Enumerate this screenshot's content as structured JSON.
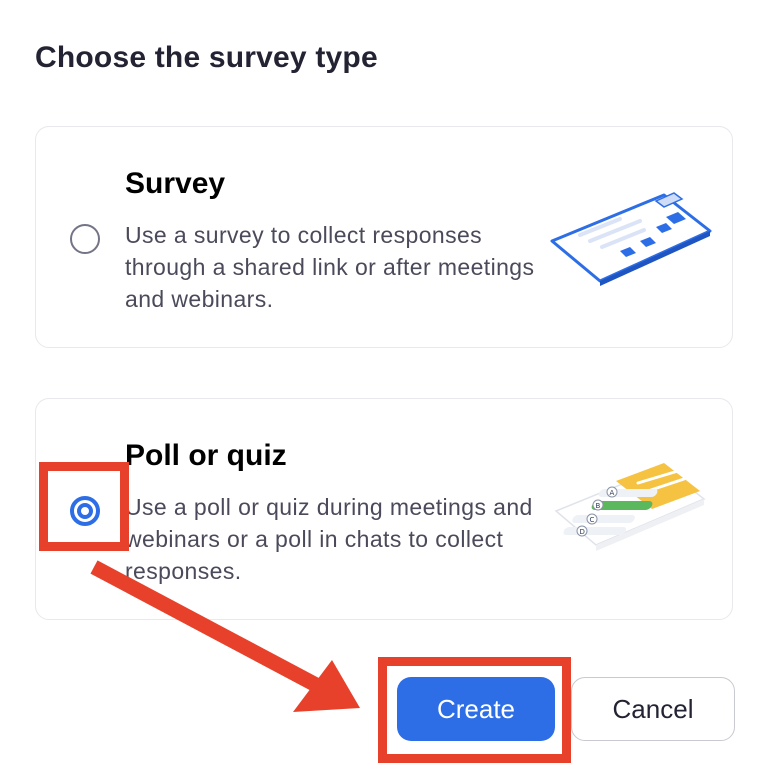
{
  "dialog": {
    "title": "Choose the survey type"
  },
  "options": [
    {
      "title": "Survey",
      "description": "Use a survey to collect responses through a shared link or after meetings and webinars.",
      "selected": false,
      "illustration": "clipboard-illustration"
    },
    {
      "title": "Poll or quiz",
      "description": "Use a poll or quiz during meetings and webinars or a poll in chats to collect responses.",
      "selected": true,
      "illustration": "quiz-card-illustration",
      "answer_letters": [
        "A",
        "B",
        "C",
        "D"
      ]
    }
  ],
  "buttons": {
    "create_label": "Create",
    "cancel_label": "Cancel"
  },
  "colors": {
    "accent": "#2d6ee6",
    "annotation": "#e8412b",
    "quiz_header": "#f5c242",
    "quiz_correct": "#5cb85c"
  }
}
